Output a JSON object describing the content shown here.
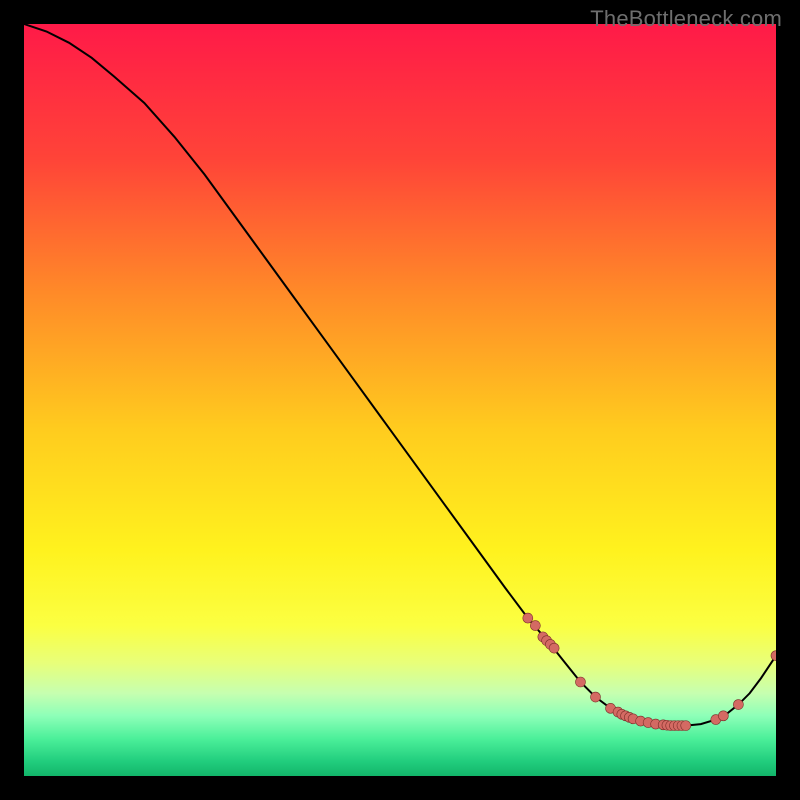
{
  "watermark": "TheBottleneck.com",
  "colors": {
    "curve": "#000000",
    "marker_fill": "#d46a63",
    "marker_stroke": "#7d2f2a"
  },
  "chart_data": {
    "type": "line",
    "title": "",
    "xlabel": "",
    "ylabel": "",
    "xlim": [
      0,
      100
    ],
    "ylim": [
      0,
      100
    ],
    "x": [
      0,
      3,
      6,
      9,
      12,
      16,
      20,
      24,
      28,
      32,
      36,
      40,
      44,
      48,
      52,
      56,
      60,
      64,
      67,
      70,
      72,
      74,
      76,
      78,
      80,
      82,
      84,
      86,
      88,
      90,
      92,
      93.5,
      95,
      96.5,
      98,
      100
    ],
    "values": [
      100,
      99,
      97.5,
      95.5,
      93,
      89.5,
      85,
      80,
      74.5,
      69,
      63.5,
      58,
      52.5,
      47,
      41.5,
      36,
      30.5,
      25,
      21,
      17.5,
      15,
      12.5,
      10.5,
      9,
      8,
      7.3,
      6.9,
      6.7,
      6.7,
      6.9,
      7.5,
      8.3,
      9.5,
      11,
      13,
      16
    ],
    "markers_x": [
      67,
      68,
      69,
      69.5,
      70,
      70.5,
      74,
      76,
      78,
      79,
      79.5,
      80,
      80.5,
      81,
      82,
      83,
      84,
      85,
      85.5,
      86,
      86.5,
      87,
      87.5,
      88,
      92,
      93,
      95,
      100
    ],
    "markers_y": [
      21,
      20,
      18.5,
      18,
      17.5,
      17,
      12.5,
      10.5,
      9,
      8.5,
      8.2,
      8.0,
      7.8,
      7.6,
      7.3,
      7.1,
      6.9,
      6.8,
      6.75,
      6.7,
      6.7,
      6.7,
      6.7,
      6.7,
      7.5,
      8.0,
      9.5,
      16
    ],
    "gradient_stops": [
      {
        "offset": 0,
        "color": "#ff1a48"
      },
      {
        "offset": 18,
        "color": "#ff4438"
      },
      {
        "offset": 36,
        "color": "#ff8b28"
      },
      {
        "offset": 54,
        "color": "#ffcc1e"
      },
      {
        "offset": 70,
        "color": "#fff21e"
      },
      {
        "offset": 80,
        "color": "#fbff42"
      },
      {
        "offset": 85,
        "color": "#e8ff7a"
      },
      {
        "offset": 89,
        "color": "#c6ffb0"
      },
      {
        "offset": 92,
        "color": "#8dffb8"
      },
      {
        "offset": 95,
        "color": "#4cf09a"
      },
      {
        "offset": 98,
        "color": "#22ce7e"
      },
      {
        "offset": 100,
        "color": "#12b56a"
      }
    ]
  }
}
